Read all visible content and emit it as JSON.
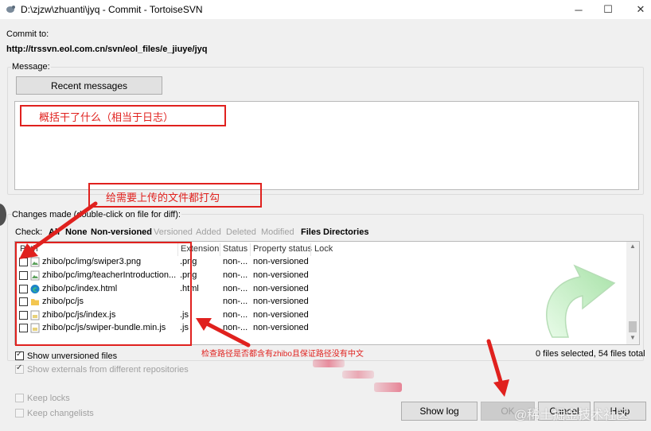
{
  "window": {
    "title": "D:\\zjzw\\zhuanti\\jyq - Commit - TortoiseSVN",
    "min_glyph": "─",
    "max_glyph": "☐",
    "close_glyph": "✕"
  },
  "commit_to": {
    "label": "Commit to:",
    "url": "http://trssvn.eol.com.cn/svn/eol_files/e_jiuye/jyq"
  },
  "message": {
    "label": "Message:",
    "recent_button": "Recent messages"
  },
  "annotations": {
    "message_hint": "概括干了什么（相当于日志）",
    "check_hint": "给需要上传的文件都打勾",
    "path_hint": "检查路径是否都含有zhibo且保证路径没有中文"
  },
  "changes": {
    "label": "Changes made (double-click on file for diff):",
    "check_label": "Check:",
    "filters": {
      "all": "All",
      "none": "None",
      "non_versioned": "Non-versioned",
      "versioned": "Versioned",
      "added": "Added",
      "deleted": "Deleted",
      "modified": "Modified",
      "files": "Files",
      "directories": "Directories"
    },
    "columns": {
      "path": "Path",
      "extension": "Extension",
      "status": "Status",
      "property_status": "Property status",
      "lock": "Lock"
    },
    "rows": [
      {
        "path": "zhibo/pc/img/swiper3.png",
        "ext": ".png",
        "status": "non-...",
        "prop": "non-versioned",
        "icon": "image-file-icon"
      },
      {
        "path": "zhibo/pc/img/teacherIntroduction...",
        "ext": ".png",
        "status": "non-...",
        "prop": "non-versioned",
        "icon": "image-file-icon"
      },
      {
        "path": "zhibo/pc/index.html",
        "ext": ".html",
        "status": "non-...",
        "prop": "non-versioned",
        "icon": "edge-html-icon"
      },
      {
        "path": "zhibo/pc/js",
        "ext": "",
        "status": "non-...",
        "prop": "non-versioned",
        "icon": "folder-icon"
      },
      {
        "path": "zhibo/pc/js/index.js",
        "ext": ".js",
        "status": "non-...",
        "prop": "non-versioned",
        "icon": "js-file-icon"
      },
      {
        "path": "zhibo/pc/js/swiper-bundle.min.js",
        "ext": ".js",
        "status": "non-...",
        "prop": "non-versioned",
        "icon": "js-file-icon"
      }
    ],
    "selection_summary": "0 files selected, 54 files total"
  },
  "options": {
    "show_unversioned": "Show unversioned files",
    "show_externals": "Show externals from different repositories",
    "keep_locks": "Keep locks",
    "keep_changelists": "Keep changelists"
  },
  "buttons": {
    "show_log": "Show log",
    "ok": "OK",
    "cancel": "Cancel",
    "help": "Help"
  },
  "watermark": "@稀土掘金技术社区",
  "colors": {
    "annotation_red": "#e0211e",
    "green_arrow": "#c8f0c8"
  }
}
